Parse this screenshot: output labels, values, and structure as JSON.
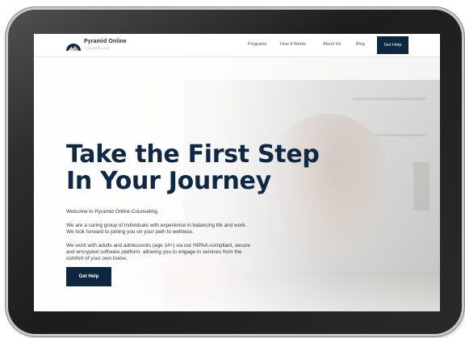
{
  "brand": {
    "name": "Pyramid Online",
    "tagline": "COUNSELING"
  },
  "nav": {
    "links": [
      "Programs",
      "How It Works",
      "About Us",
      "Blog"
    ],
    "cta_label": "Get Help"
  },
  "hero": {
    "title_line1": "Take the First Step",
    "title_line2": "In Your Journey",
    "welcome": "Welcome to Pyramid Online Counseling.",
    "para2_line1": "We are a caring group of individuals with experience in balancing life and work.",
    "para2_line2": "We look forward to joining you on your path to wellness.",
    "para3_line1": "We work with adults and adolescents (age 14+) via our HIPAA-compliant, secure",
    "para3_line2": "and encrypted software platform, allowing you to engage in services from the",
    "para3_line3": "comfort of your own home.",
    "cta_label": "Get Help"
  },
  "colors": {
    "primary": "#0e2740",
    "title": "#0f2843",
    "text": "#2e3740"
  }
}
